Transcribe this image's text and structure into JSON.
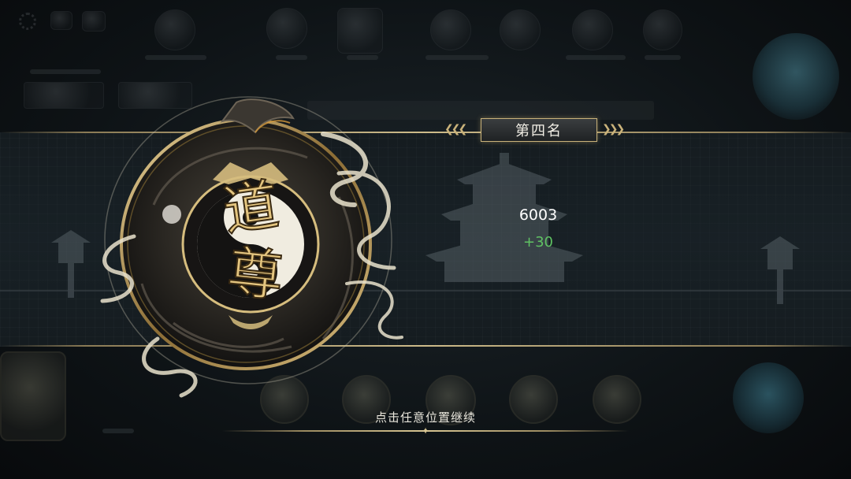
{
  "result": {
    "rank_label": "第四名",
    "score": "6003",
    "score_change": "+30"
  },
  "emblem": {
    "title_chars": [
      "道",
      "尊"
    ],
    "icon": "taiji-dragon-emblem-icon"
  },
  "prompt": {
    "continue_text": "点击任意位置继续"
  },
  "colors": {
    "accent_gold": "#c9b27a",
    "score_gain_green": "#5fc163",
    "text_white": "#ffffff"
  }
}
